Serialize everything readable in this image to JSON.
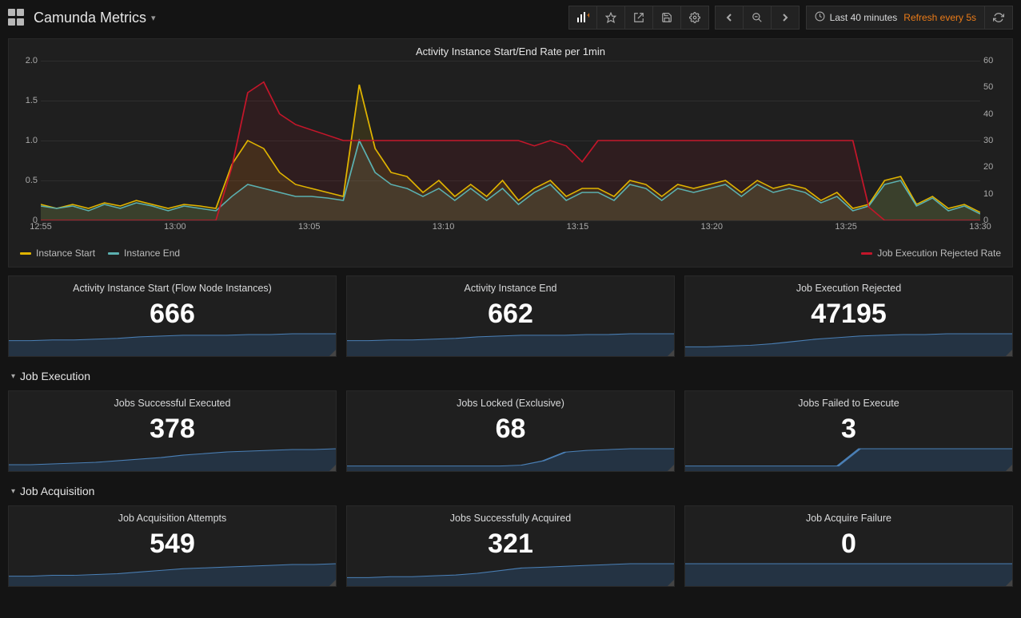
{
  "header": {
    "title": "Camunda Metrics",
    "time_range": "Last 40 minutes",
    "refresh": "Refresh every 5s"
  },
  "main_panel": {
    "title": "Activity Instance Start/End Rate per 1min",
    "legend": {
      "left": [
        {
          "label": "Instance Start",
          "color": "#e0b400"
        },
        {
          "label": "Instance End",
          "color": "#5bb0b0"
        }
      ],
      "right": {
        "label": "Job Execution Rejected Rate",
        "color": "#c4162a"
      }
    }
  },
  "chart_data": {
    "type": "line",
    "title": "Activity Instance Start/End Rate per 1min",
    "xlabel": "",
    "ylabel_left": "",
    "ylabel_right": "",
    "ylim_left": [
      0,
      2.0
    ],
    "ylim_right": [
      0,
      60
    ],
    "x_ticks": [
      "12:55",
      "13:00",
      "13:05",
      "13:10",
      "13:15",
      "13:20",
      "13:25",
      "13:30"
    ],
    "y_ticks_left": [
      0,
      0.5,
      1.0,
      1.5,
      2.0
    ],
    "y_ticks_right": [
      0,
      10,
      20,
      30,
      40,
      50,
      60
    ],
    "series": [
      {
        "name": "Instance Start",
        "axis": "left",
        "color": "#e0b400",
        "values": [
          0.2,
          0.15,
          0.2,
          0.15,
          0.22,
          0.18,
          0.25,
          0.2,
          0.15,
          0.2,
          0.18,
          0.15,
          0.7,
          1.0,
          0.9,
          0.6,
          0.45,
          0.4,
          0.35,
          0.3,
          1.7,
          0.9,
          0.6,
          0.55,
          0.35,
          0.5,
          0.3,
          0.45,
          0.3,
          0.5,
          0.25,
          0.4,
          0.5,
          0.3,
          0.4,
          0.4,
          0.3,
          0.5,
          0.45,
          0.3,
          0.45,
          0.4,
          0.45,
          0.5,
          0.35,
          0.5,
          0.4,
          0.45,
          0.4,
          0.25,
          0.35,
          0.15,
          0.2,
          0.5,
          0.55,
          0.2,
          0.3,
          0.15,
          0.2,
          0.1
        ]
      },
      {
        "name": "Instance End",
        "axis": "left",
        "color": "#5bb0b0",
        "values": [
          0.18,
          0.15,
          0.18,
          0.12,
          0.2,
          0.15,
          0.22,
          0.18,
          0.12,
          0.18,
          0.15,
          0.12,
          0.3,
          0.45,
          0.4,
          0.35,
          0.3,
          0.3,
          0.28,
          0.25,
          1.0,
          0.6,
          0.45,
          0.4,
          0.3,
          0.4,
          0.25,
          0.4,
          0.25,
          0.4,
          0.2,
          0.35,
          0.45,
          0.25,
          0.35,
          0.35,
          0.25,
          0.45,
          0.4,
          0.25,
          0.4,
          0.35,
          0.4,
          0.45,
          0.3,
          0.45,
          0.35,
          0.4,
          0.35,
          0.22,
          0.3,
          0.12,
          0.18,
          0.45,
          0.5,
          0.18,
          0.28,
          0.12,
          0.18,
          0.08
        ]
      },
      {
        "name": "Job Execution Rejected Rate",
        "axis": "right",
        "color": "#c4162a",
        "values": [
          0,
          0,
          0,
          0,
          0,
          0,
          0,
          0,
          0,
          0,
          0,
          0,
          20,
          48,
          52,
          40,
          36,
          34,
          32,
          30,
          30,
          30,
          30,
          30,
          30,
          30,
          30,
          30,
          30,
          30,
          30,
          28,
          30,
          28,
          22,
          30,
          30,
          30,
          30,
          30,
          30,
          30,
          30,
          30,
          30,
          30,
          30,
          30,
          30,
          30,
          30,
          30,
          5,
          0,
          0,
          0,
          0,
          0,
          0,
          0
        ]
      }
    ]
  },
  "row1": [
    {
      "id": "activity-instance-start",
      "title": "Activity Instance Start (Flow Node Instances)",
      "value": "666",
      "spark": [
        18,
        18,
        19,
        19,
        20,
        21,
        23,
        24,
        25,
        25,
        25,
        26,
        26,
        27,
        27,
        27
      ]
    },
    {
      "id": "activity-instance-end",
      "title": "Activity Instance End",
      "value": "662",
      "spark": [
        18,
        18,
        19,
        19,
        20,
        21,
        23,
        24,
        25,
        25,
        25,
        26,
        26,
        27,
        27,
        27
      ]
    },
    {
      "id": "job-execution-rejected",
      "title": "Job Execution Rejected",
      "value": "47195",
      "spark": [
        10,
        10,
        11,
        12,
        14,
        17,
        20,
        22,
        24,
        25,
        26,
        26,
        27,
        27,
        27,
        27
      ]
    }
  ],
  "section1": "Job Execution",
  "row2": [
    {
      "id": "jobs-successful-executed",
      "title": "Jobs Successful Executed",
      "value": "378",
      "spark": [
        6,
        6,
        7,
        8,
        9,
        11,
        13,
        15,
        18,
        20,
        22,
        23,
        24,
        25,
        25,
        26
      ]
    },
    {
      "id": "jobs-locked-exclusive",
      "title": "Jobs Locked (Exclusive)",
      "value": "68",
      "spark": [
        4,
        4,
        4,
        4,
        4,
        4,
        4,
        4,
        5,
        10,
        20,
        22,
        23,
        24,
        24,
        24
      ]
    },
    {
      "id": "jobs-failed-to-execute",
      "title": "Jobs Failed to Execute",
      "value": "3",
      "spark": [
        4,
        4,
        4,
        4,
        4,
        4,
        4,
        4,
        24,
        24,
        24,
        24,
        24,
        24,
        24,
        24
      ]
    }
  ],
  "section2": "Job Acquisition",
  "row3": [
    {
      "id": "job-acquisition-attempts",
      "title": "Job Acquisition Attempts",
      "value": "549",
      "spark": [
        10,
        10,
        11,
        11,
        12,
        13,
        15,
        17,
        19,
        20,
        21,
        22,
        23,
        24,
        24,
        25
      ]
    },
    {
      "id": "jobs-successfully-acquired",
      "title": "Jobs Successfully Acquired",
      "value": "321",
      "spark": [
        8,
        8,
        9,
        9,
        10,
        11,
        13,
        16,
        19,
        20,
        21,
        22,
        23,
        24,
        24,
        24
      ]
    },
    {
      "id": "job-acquire-failure",
      "title": "Job Acquire Failure",
      "value": "0",
      "spark": [
        4,
        4,
        4,
        4,
        4,
        4,
        4,
        4,
        4,
        4,
        4,
        4,
        4,
        4,
        4,
        4
      ]
    }
  ]
}
